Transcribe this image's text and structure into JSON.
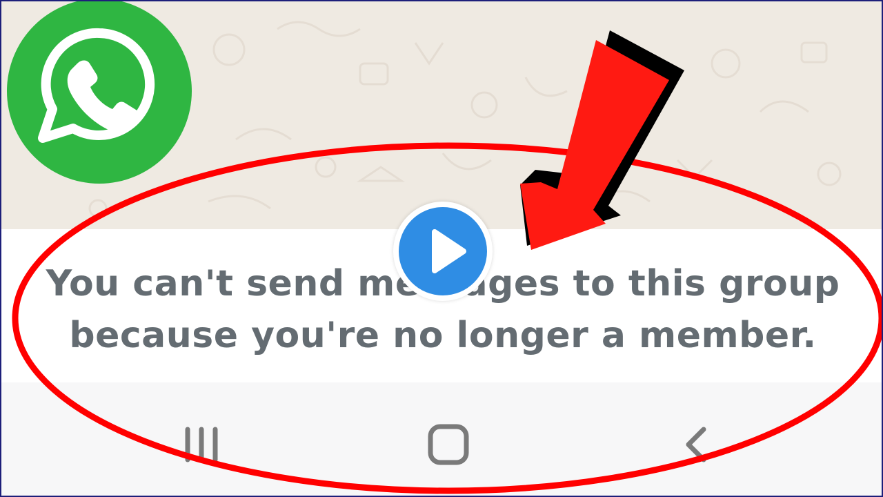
{
  "chat_notice": {
    "line1": "You can't send messages to this group",
    "line2": "because you're no longer a member."
  },
  "navigation_bar": {
    "buttons": [
      {
        "name": "recent-apps",
        "icon": "recent-apps-icon"
      },
      {
        "name": "home",
        "icon": "home-icon"
      },
      {
        "name": "back",
        "icon": "back-chevron-icon"
      }
    ]
  },
  "overlay": {
    "logo": "whatsapp-logo-icon",
    "play": "play-icon",
    "annotation_arrow": "red-arrow-icon",
    "annotation_ellipse": "red-ellipse-highlight"
  },
  "colors": {
    "whatsapp_green": "#2fb642",
    "annotation_red": "#ff0000",
    "play_blue": "#2f8de4",
    "text_gray": "#646c72",
    "chat_background": "#efeae2"
  }
}
